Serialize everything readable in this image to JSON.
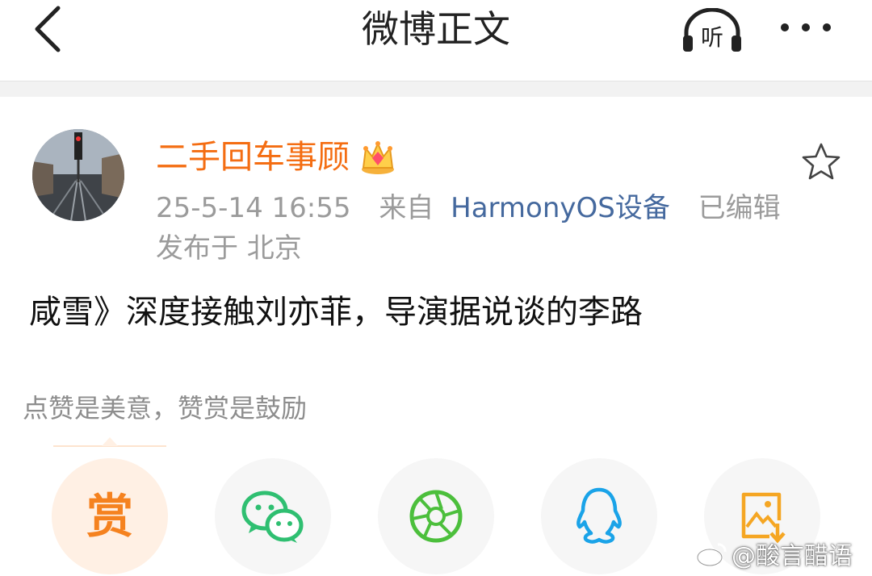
{
  "nav": {
    "title": "微博正文",
    "listen_label": "听"
  },
  "post": {
    "author": "二手回车事顾",
    "timestamp": "25-5-14 16:55",
    "source_prefix": "来自",
    "source": "HarmonyOS设备",
    "edited": "已编辑",
    "location": "发布于 北京",
    "text": "咸雪》深度接触刘亦菲，导演据说谈的李路"
  },
  "reward": {
    "hint": "点赞是美意，赞赏是鼓励",
    "button_label": "赏"
  },
  "share_targets": [
    {
      "icon": "reward-icon"
    },
    {
      "icon": "wechat-icon"
    },
    {
      "icon": "moments-icon"
    },
    {
      "icon": "qq-icon"
    },
    {
      "icon": "save-image-icon"
    }
  ],
  "watermark": {
    "text": "@酸言醋语"
  },
  "colors": {
    "username": "#f46d12",
    "source_link": "#45699e",
    "reward": "#f5821f",
    "wechat": "#2fbf71",
    "moments": "#4cbf3c",
    "qq": "#1aa3e8",
    "save": "#f5a623"
  }
}
